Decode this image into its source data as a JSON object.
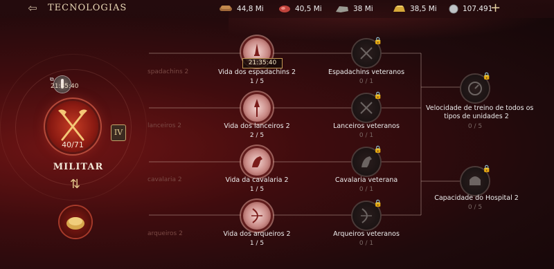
{
  "header": {
    "title": "TECNOLOGIAS",
    "back_icon": "back-arrow-icon"
  },
  "resources": [
    {
      "icon": "wood-icon",
      "value": "44,8 Mi"
    },
    {
      "icon": "meat-icon",
      "value": "40,5 Mi"
    },
    {
      "icon": "stone-icon",
      "value": "38 Mi"
    },
    {
      "icon": "gold-icon",
      "value": "38,5 Mi"
    },
    {
      "icon": "silver-coin-icon",
      "value": "107.491"
    }
  ],
  "add_label": "+",
  "category": {
    "name": "MILITAR",
    "progress": "40/71",
    "level": "IV",
    "timer": "21:35:40",
    "progress_fraction": 0.56
  },
  "swap_icon": "swap-arrows-icon",
  "rows": [
    {
      "ghost": "spadachins 2",
      "active": {
        "name": "Vida dos espadachins 2",
        "progress": "1 / 5",
        "timer": "21:35:40"
      },
      "locked": {
        "name": "Espadachins veteranos",
        "progress": "0 / 1"
      }
    },
    {
      "ghost": "lanceiros 2",
      "active": {
        "name": "Vida dos lanceiros 2",
        "progress": "2 / 5"
      },
      "locked": {
        "name": "Lanceiros veteranos",
        "progress": "0 / 1"
      }
    },
    {
      "ghost": "cavalaria 2",
      "active": {
        "name": "Vida da cavalaria 2",
        "progress": "1 / 5"
      },
      "locked": {
        "name": "Cavalaria veterana",
        "progress": "0 / 1"
      }
    },
    {
      "ghost": "arqueiros 2",
      "active": {
        "name": "Vida dos arqueiros 2",
        "progress": "1 / 5"
      },
      "locked": {
        "name": "Arqueiros veteranos",
        "progress": "0 / 1"
      }
    }
  ],
  "final": [
    {
      "name_line1": "Velocidade de treino de todos os",
      "name_line2": "tipos de unidades 2",
      "progress": "0 / 5"
    },
    {
      "name_line1": "Capacidade do Hospital 2",
      "progress": "0 / 5"
    }
  ]
}
